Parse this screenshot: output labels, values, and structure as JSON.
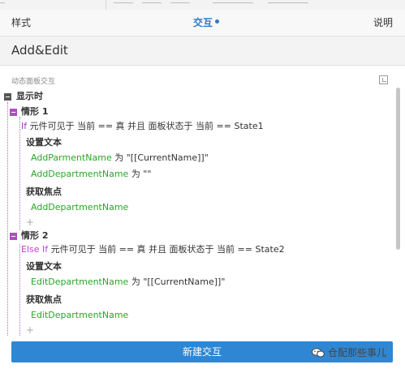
{
  "tabs": [
    {
      "label": "样式"
    },
    {
      "label": "交互"
    },
    {
      "label": "说明"
    }
  ],
  "title": "Add&Edit",
  "section_label": "动态面板交互",
  "event": {
    "label": "显示时"
  },
  "case1": {
    "label": "情形 1",
    "condition_keyword": "If",
    "condition_text": "元件可见于 当前 == 真 并且 面板状态于 当前 == State1",
    "set_text_label": "设置文本",
    "actions": [
      {
        "target": "AddParmentName",
        "text": "为 \"[[CurrentName]]\""
      },
      {
        "target": "AddDepartmentName",
        "text": "为 \"\""
      }
    ],
    "focus_label": "获取焦点",
    "focus_target": "AddDepartmentName",
    "plus": "+"
  },
  "case2": {
    "label": "情形 2",
    "condition_keyword": "Else If",
    "condition_text": "元件可见于 当前 == 真 并且 面板状态于 当前 == State2",
    "set_text_label": "设置文本",
    "actions": [
      {
        "target": "EditDepartmentName",
        "text": "为 \"[[CurrentName]]\""
      }
    ],
    "focus_label": "获取焦点",
    "focus_target": "EditDepartmentName",
    "plus": "+"
  },
  "new_interaction": "新建交互",
  "watermark": "仓配那些事儿",
  "colors": {
    "accent": "#2f77c9",
    "button": "#2f87d3",
    "action": "#2aa52a",
    "case": "#b04cc4"
  }
}
